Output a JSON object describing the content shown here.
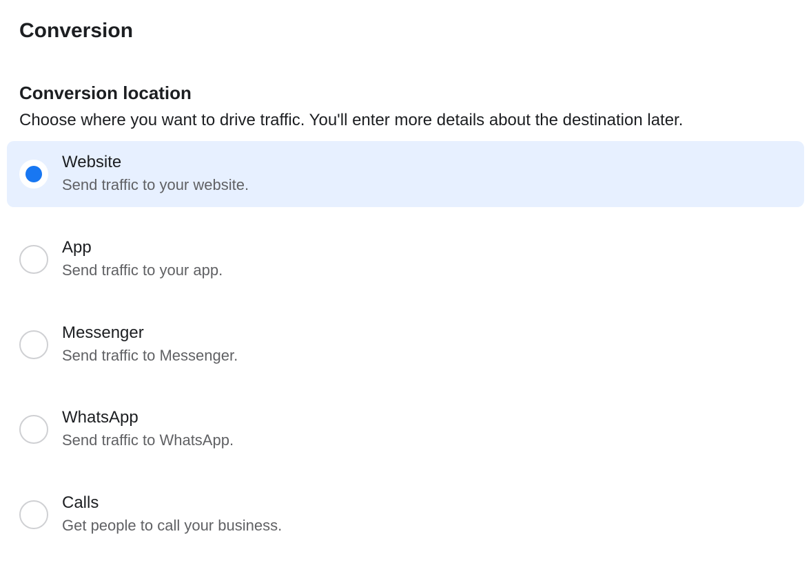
{
  "pageTitle": "Conversion",
  "section": {
    "heading": "Conversion location",
    "subtext": "Choose where you want to drive traffic. You'll enter more details about the destination later."
  },
  "options": [
    {
      "title": "Website",
      "description": "Send traffic to your website.",
      "selected": true
    },
    {
      "title": "App",
      "description": "Send traffic to your app.",
      "selected": false
    },
    {
      "title": "Messenger",
      "description": "Send traffic to Messenger.",
      "selected": false
    },
    {
      "title": "WhatsApp",
      "description": "Send traffic to WhatsApp.",
      "selected": false
    },
    {
      "title": "Calls",
      "description": "Get people to call your business.",
      "selected": false
    }
  ]
}
